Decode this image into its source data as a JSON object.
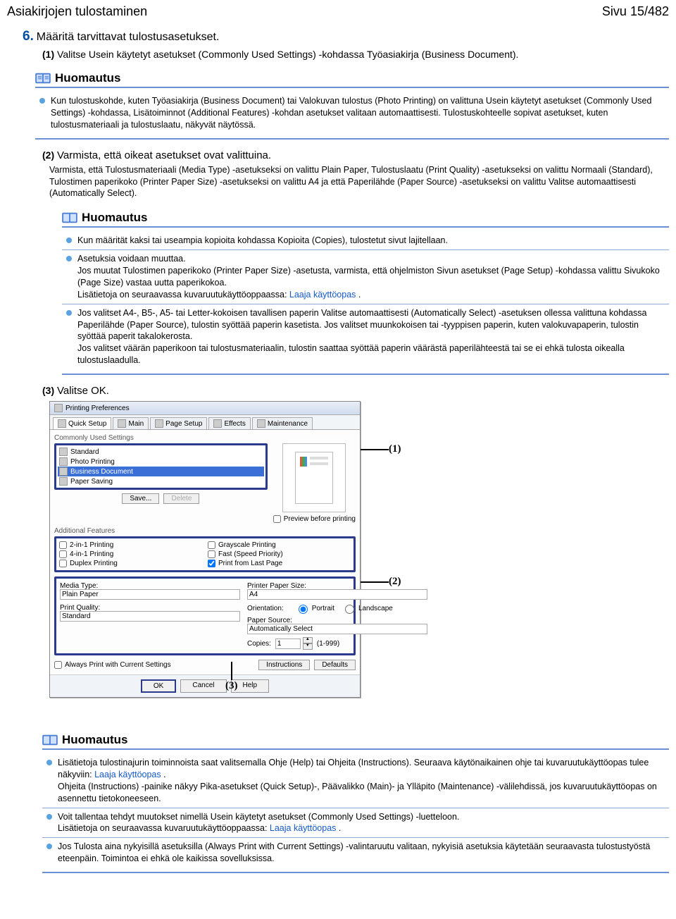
{
  "header": {
    "left": "Asiakirjojen tulostaminen",
    "right": "Sivu 15/482"
  },
  "step6": {
    "num": "6.",
    "title": "Määritä tarvittavat tulostusasetukset.",
    "sub1_num": "(1)",
    "sub1_text": "Valitse Usein käytetyt asetukset (Commonly Used Settings) -kohdassa Työasiakirja (Business Document)."
  },
  "note1": {
    "title": "Huomautus",
    "body": "Kun tulostuskohde, kuten Työasiakirja (Business Document) tai Valokuvan tulostus (Photo Printing) on valittuna Usein käytetyt asetukset (Commonly Used Settings) -kohdassa, Lisätoiminnot (Additional Features) -kohdan asetukset valitaan automaattisesti. Tulostuskohteelle sopivat asetukset, kuten tulostusmateriaali ja tulostuslaatu, näkyvät näytössä."
  },
  "sub2": {
    "num": "(2)",
    "title": "Varmista, että oikeat asetukset ovat valittuina.",
    "para": "Varmista, että Tulostusmateriaali (Media Type) -asetukseksi on valittu Plain Paper, Tulostuslaatu (Print Quality) -asetukseksi on valittu Normaali (Standard), Tulostimen paperikoko (Printer Paper Size) -asetukseksi on valittu A4 ja että Paperilähde (Paper Source) -asetukseksi on valittu Valitse automaattisesti (Automatically Select)."
  },
  "note2": {
    "title": "Huomautus",
    "items": [
      "Kun määrität kaksi tai useampia kopioita kohdassa Kopioita (Copies), tulostetut sivut lajitellaan.",
      "Asetuksia voidaan muuttaa.\nJos muutat Tulostimen paperikoko (Printer Paper Size) -asetusta, varmista, että ohjelmiston Sivun asetukset (Page Setup) -kohdassa valittu Sivukoko (Page Size) vastaa uutta paperikokoa.\nLisätietoja on seuraavassa kuvaruutukäyttöoppaassa:    Laaja käyttöopas   .",
      "Jos valitset A4-, B5-, A5- tai Letter-kokoisen tavallisen paperin Valitse automaattisesti (Automatically Select) -asetuksen ollessa valittuna kohdassa Paperilähde (Paper Source), tulostin syöttää paperin kasetista. Jos valitset muunkokoisen tai -tyyppisen paperin, kuten valokuvapaperin, tulostin syöttää paperit takalokerosta.\nJos valitset väärän paperikoon tai tulostusmateriaalin, tulostin saattaa syöttää paperin väärästä paperilähteestä tai se ei ehkä tulosta oikealla tulostuslaadulla."
    ]
  },
  "sub3": {
    "num": "(3)",
    "title": "Valitse OK."
  },
  "dialog": {
    "title": "Printing Preferences",
    "tabs": [
      "Quick Setup",
      "Main",
      "Page Setup",
      "Effects",
      "Maintenance"
    ],
    "commonly_label": "Commonly Used Settings",
    "list": [
      "Standard",
      "Photo Printing",
      "Business Document",
      "Paper Saving"
    ],
    "save": "Save...",
    "delete": "Delete",
    "preview_cb": "Preview before printing",
    "features_label": "Additional Features",
    "features": [
      {
        "label": "2-in-1 Printing",
        "checked": false
      },
      {
        "label": "Grayscale Printing",
        "checked": false
      },
      {
        "label": "4-in-1 Printing",
        "checked": false
      },
      {
        "label": "Fast (Speed Priority)",
        "checked": false
      },
      {
        "label": "Duplex Printing",
        "checked": false
      },
      {
        "label": "Print from Last Page",
        "checked": true
      }
    ],
    "media_type_label": "Media Type:",
    "media_type": "Plain Paper",
    "paper_size_label": "Printer Paper Size:",
    "paper_size": "A4",
    "quality_label": "Print Quality:",
    "quality": "Standard",
    "orient_label": "Orientation:",
    "orient_p": "Portrait",
    "orient_l": "Landscape",
    "source_label": "Paper Source:",
    "source": "Automatically Select",
    "copies_label": "Copies:",
    "copies": "1",
    "copies_range": "(1-999)",
    "always_cb": "Always Print with Current Settings",
    "instructions_btn": "Instructions",
    "defaults_btn": "Defaults",
    "ok": "OK",
    "cancel": "Cancel",
    "help": "Help",
    "callouts": {
      "c1": "(1)",
      "c2": "(2)",
      "c3": "(3)"
    }
  },
  "note3": {
    "title": "Huomautus",
    "items": [
      "Lisätietoja tulostinajurin toiminnoista saat valitsemalla Ohje (Help) tai Ohjeita (Instructions). Seuraava käytönaikainen ohje tai kuvaruutukäyttöopas tulee näkyviin:            Laaja käyttöopas   .\nOhjeita (Instructions) -painike näkyy Pika-asetukset (Quick Setup)-, Päävalikko (Main)- ja Ylläpito (Maintenance) -välilehdissä, jos kuvaruutukäyttöopas on asennettu tietokoneeseen.",
      "Voit tallentaa tehdyt muutokset nimellä Usein käytetyt asetukset (Commonly Used Settings) -luetteloon.\nLisätietoja on seuraavassa kuvaruutukäyttöoppaassa:    Laaja käyttöopas   .",
      "Jos Tulosta aina nykyisillä asetuksilla (Always Print with Current Settings) -valintaruutu valitaan, nykyisiä asetuksia käytetään seuraavasta tulostustyöstä eteenpäin. Toimintoa ei ehkä ole kaikissa sovelluksissa."
    ]
  }
}
